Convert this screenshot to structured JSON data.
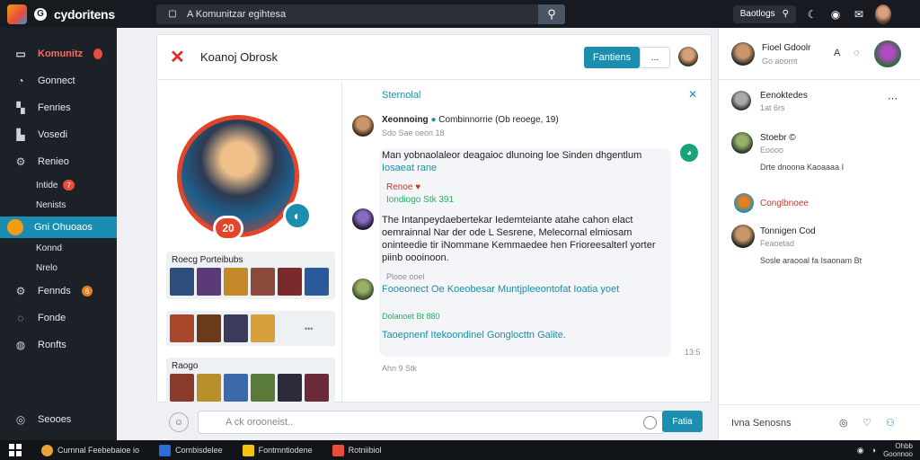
{
  "topbar": {
    "logo_text": "cydoritens",
    "search_text": "A Komunitzar egihtesa",
    "pill_label": "Baotlogs",
    "icons": [
      "search-icon",
      "moon-icon",
      "chat-icon",
      "mail-icon",
      "avatar"
    ]
  },
  "sidebar": {
    "items": [
      {
        "label": "Komunitz",
        "icon": "window-icon"
      },
      {
        "label": "Gonnect",
        "icon": "bell-icon"
      },
      {
        "label": "Fenries",
        "icon": "chart-icon"
      },
      {
        "label": "Vosedi",
        "icon": "bar-icon"
      },
      {
        "label": "Renieo",
        "icon": "gear-icon"
      }
    ],
    "sub_items": [
      {
        "label": "Intide",
        "badge": "7"
      },
      {
        "label": "Nenists",
        "badge": ""
      }
    ],
    "active_item": "Gni Ohuoaos",
    "more_items": [
      {
        "label": "Konnd"
      },
      {
        "label": "Nrelo"
      },
      {
        "label": "Fennds",
        "badge": "6",
        "icon": "gear-icon"
      },
      {
        "label": "Fonde",
        "icon": "chat-icon"
      },
      {
        "label": "Ronfts",
        "icon": "globe-icon"
      }
    ],
    "bottom_item": "Seooes"
  },
  "main": {
    "title": "Koanoj Obrosk",
    "primary_button": "Fantiens",
    "ghost_button": "...",
    "profile_badge": "20",
    "gallery1_title": "Roecg Porteibubs",
    "gallery3_title": "Raogo",
    "more_dots": "•••"
  },
  "thread": {
    "title": "Sternolal",
    "close": "✕",
    "author": "Xeonnoing",
    "author_sub": "Combinnorrie (Ob reoege, 19)",
    "author_meta": "Sdo Sae oeon 18",
    "body1": "Man yobnaolaleor deagaioc dlunoing loe Sinden dhgentlum",
    "body1_tag": "Iosaeat rane",
    "reply_name": "Renoe",
    "reply_tags": "Iondiogo  Stk 391",
    "body2": "The Intanpeydaebertekar Iedemteiante atahe cahon elact oemrainnal Nar der ode L Sesrene, Melecornal elmiosam oninteedie tir iNommane Kemmaedee hen Frioreesalterl yorter piinb oooinoon.",
    "reply2_meta": "Plooe ooel",
    "body3": "Fooeonect Oe Koeobesar Muntjpleeontofat Ioatia yoet",
    "reply3_meta": "Dolanoet Bt 880",
    "body4": "Taoepnenf Itekoondinel  Gonglocttn Galite.",
    "time": "13:5",
    "footer_meta": "Ahn 9 Stk"
  },
  "composer": {
    "placeholder": "A ck orooneist..",
    "send": "Fatia"
  },
  "rpanel": {
    "head_name": "Fioel Gdoolr",
    "head_sub": "Go aoomt",
    "head_icon": "A",
    "contacts": [
      {
        "name": "Eenoktedes",
        "sub": "1at 6rs"
      },
      {
        "name": "Stoebr  ©",
        "sub": "Eoooo",
        "extra": "Drte dnoona Kaoaaaa I"
      },
      {
        "name": "Conglbnoee",
        "sub": ""
      },
      {
        "name": "Tonnigen Cod",
        "sub": "Feaoetad",
        "extra": "Sosle araooal fa Isaonam  Bt"
      }
    ],
    "footer": "Ivna Senosns"
  },
  "taskbar": {
    "apps": [
      "Curnnal Feebebaioe io",
      "Combisdelee",
      "Fontmntiodene",
      "Rotniibiol"
    ],
    "clock_line1": "Ohbb",
    "clock_line2": "Goonnoo"
  }
}
